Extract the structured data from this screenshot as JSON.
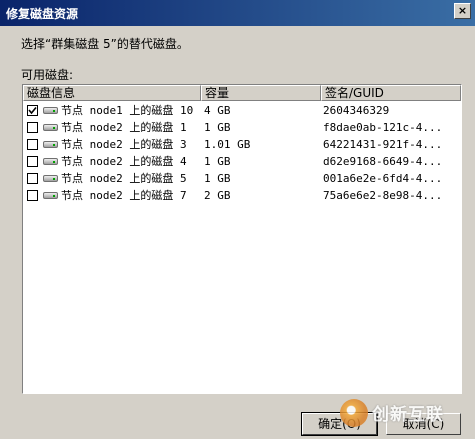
{
  "window": {
    "title": "修复磁盘资源",
    "close_glyph": "×"
  },
  "instruction": "选择“群集磁盘 5”的替代磁盘。",
  "group_label": "可用磁盘:",
  "columns": [
    "磁盘信息",
    "容量",
    "签名/GUID"
  ],
  "rows": [
    {
      "checked": true,
      "name": "节点 node1 上的磁盘 10",
      "size": "4 GB",
      "signature": "2604346329"
    },
    {
      "checked": false,
      "name": "节点 node2 上的磁盘 1",
      "size": "1 GB",
      "signature": "f8dae0ab-121c-4..."
    },
    {
      "checked": false,
      "name": "节点 node2 上的磁盘 3",
      "size": "1.01 GB",
      "signature": "64221431-921f-4..."
    },
    {
      "checked": false,
      "name": "节点 node2 上的磁盘 4",
      "size": "1 GB",
      "signature": "d62e9168-6649-4..."
    },
    {
      "checked": false,
      "name": "节点 node2 上的磁盘 5",
      "size": "1 GB",
      "signature": "001a6e2e-6fd4-4..."
    },
    {
      "checked": false,
      "name": "节点 node2 上的磁盘 7",
      "size": "2 GB",
      "signature": "75a6e6e2-8e98-4..."
    }
  ],
  "buttons": {
    "ok": "确定(O)",
    "cancel": "取消(C)"
  },
  "watermark": "创新互联",
  "icons": {
    "disk": "disk-drive-icon",
    "check": "checkmark-icon"
  }
}
